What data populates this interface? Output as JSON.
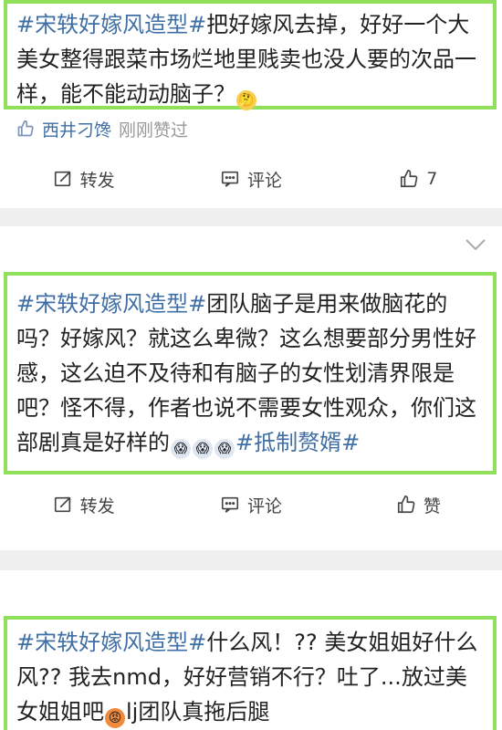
{
  "posts": [
    {
      "hashtag": "#宋轶好嫁风造型#",
      "text": "把好嫁风去掉，好好一个大美女整得跟菜市场烂地里贱卖也没人要的次品一样，能不能动动脑子？",
      "emoji": "🤔",
      "liker_name": "西井刁馋",
      "liker_status": "刚刚赞过",
      "actions": {
        "share": "转发",
        "comment": "评论",
        "like": "7"
      }
    },
    {
      "hashtag": "#宋轶好嫁风造型#",
      "text": "团队脑子是用来做脑花的吗？好嫁风？就这么卑微？这么想要部分男性好感，这么迫不及待和有脑子的女性划清界限是吧？怪不得，作者也说不需要女性观众，你们这部剧真是好样的",
      "emojis": [
        "😱",
        "😱",
        "😱"
      ],
      "hashtag_end": "#抵制赘婿#",
      "actions": {
        "share": "转发",
        "comment": "评论",
        "like": "赞"
      }
    },
    {
      "hashtag": "#宋轶好嫁风造型#",
      "text_a": "什么风！?? 美女姐姐好什么风?? 我去nmd，好好营销不行？吐了...放过美女姐姐吧",
      "emoji": "😡",
      "text_b": "lj团队真拖后腿"
    }
  ],
  "colors": {
    "accent_green": "#8fe05a",
    "link_blue": "#3f6fa5"
  }
}
